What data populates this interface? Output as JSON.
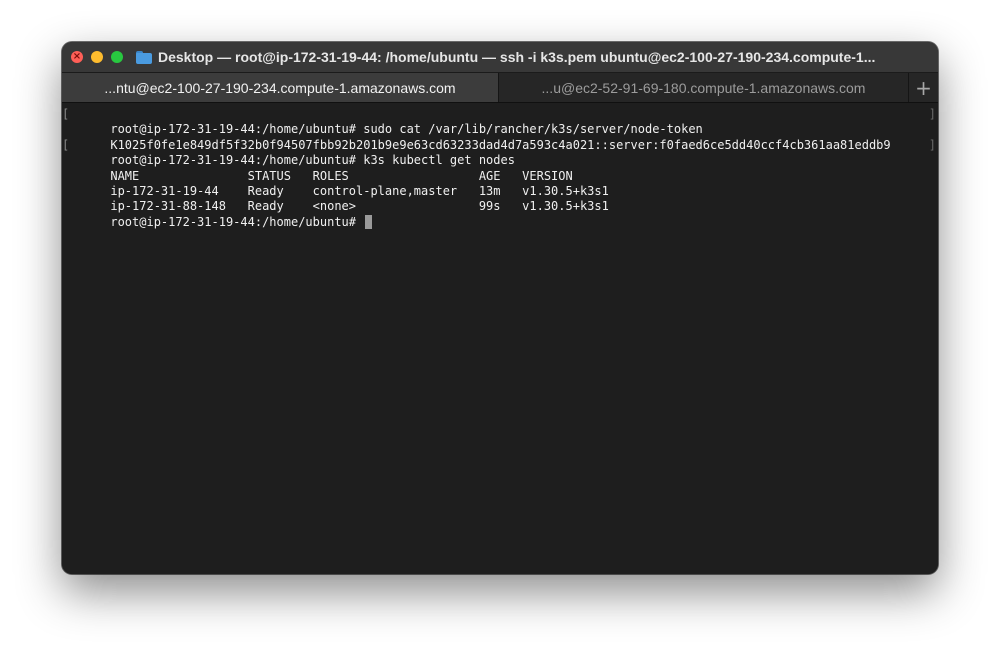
{
  "window": {
    "title": "Desktop — root@ip-172-31-19-44: /home/ubuntu — ssh -i k3s.pem ubuntu@ec2-100-27-190-234.compute-1..."
  },
  "tabs": [
    {
      "label": "...ntu@ec2-100-27-190-234.compute-1.amazonaws.com",
      "active": true
    },
    {
      "label": "...u@ec2-52-91-69-180.compute-1.amazonaws.com",
      "active": false
    }
  ],
  "new_tab_symbol": "+",
  "terminal": {
    "lines": [
      "root@ip-172-31-19-44:/home/ubuntu# sudo cat /var/lib/rancher/k3s/server/node-token",
      "K1025f0fe1e849df5f32b0f94507fbb92b201b9e9e63cd63233dad4d7a593c4a021::server:f0faed6ce5dd40ccf4cb361aa81eddb9",
      "root@ip-172-31-19-44:/home/ubuntu# k3s kubectl get nodes",
      "NAME               STATUS   ROLES                  AGE   VERSION",
      "ip-172-31-19-44    Ready    control-plane,master   13m   v1.30.5+k3s1",
      "ip-172-31-88-148   Ready    <none>                 99s   v1.30.5+k3s1"
    ],
    "prompt": "root@ip-172-31-19-44:/home/ubuntu# ",
    "bracket_left": "[",
    "bracket_right": "]"
  },
  "colors": {
    "close": "#ff5f57",
    "minimize": "#febc2e",
    "maximize": "#28c840",
    "terminal_bg": "#1e1e1e",
    "terminal_fg": "#f0f0f0"
  }
}
